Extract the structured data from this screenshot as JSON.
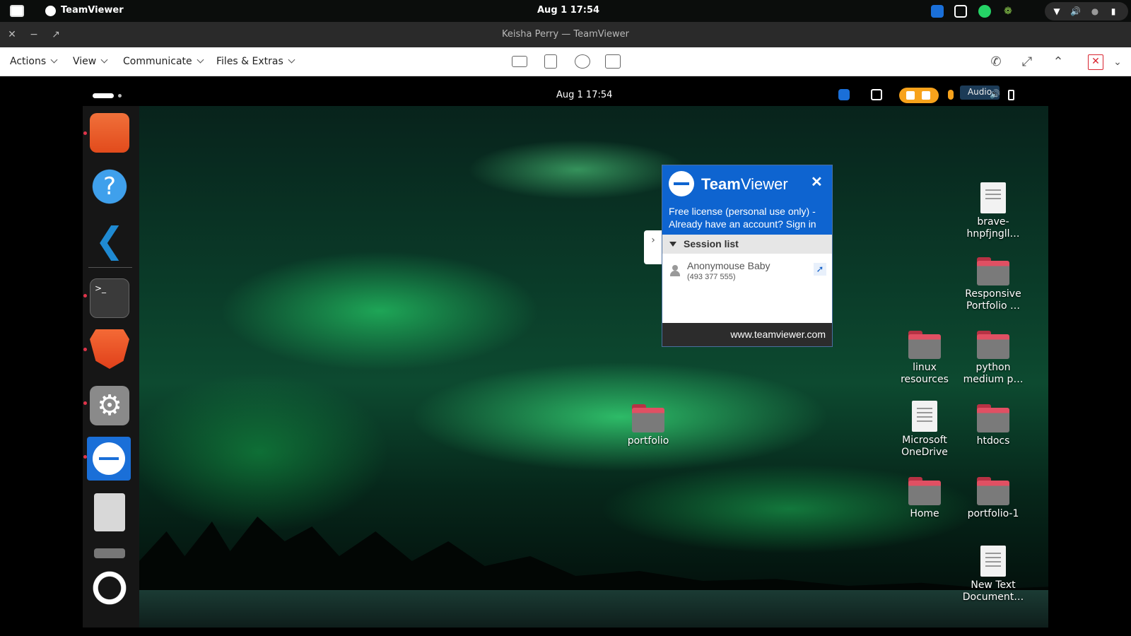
{
  "host": {
    "app_name": "TeamViewer",
    "clock": "Aug 1  17:54"
  },
  "window": {
    "title": "Keisha Perry — TeamViewer"
  },
  "menubar": {
    "actions": "Actions",
    "view": "View",
    "communicate": "Communicate",
    "files_extras": "Files & Extras"
  },
  "remote_panel": {
    "clock": "Aug 1  17:54",
    "audio_tooltip": "Audio"
  },
  "desktop_icons": {
    "brave": "brave-hnpfjngll…",
    "responsive": "Responsive Portfolio …",
    "linux": "linux resources",
    "python": "python medium p…",
    "onedrive": "Microsoft OneDrive",
    "htdocs": "htdocs",
    "home": "Home",
    "portfolio1": "portfolio-1",
    "newtext": "New Text Document…",
    "portfolio": "portfolio"
  },
  "teamviewer_popup": {
    "brand_bold": "Team",
    "brand_light": "Viewer",
    "license_text": "Free license (personal use only) - Already have an account? Sign in",
    "session_header": "Session list",
    "session_name": "Anonymouse Baby",
    "session_id": "(493 377 555)",
    "footer": "www.teamviewer.com"
  },
  "colors": {
    "teamviewer_blue": "#0e64d0",
    "share_orange": "#f7a21b",
    "folder_red": "#e05063"
  }
}
